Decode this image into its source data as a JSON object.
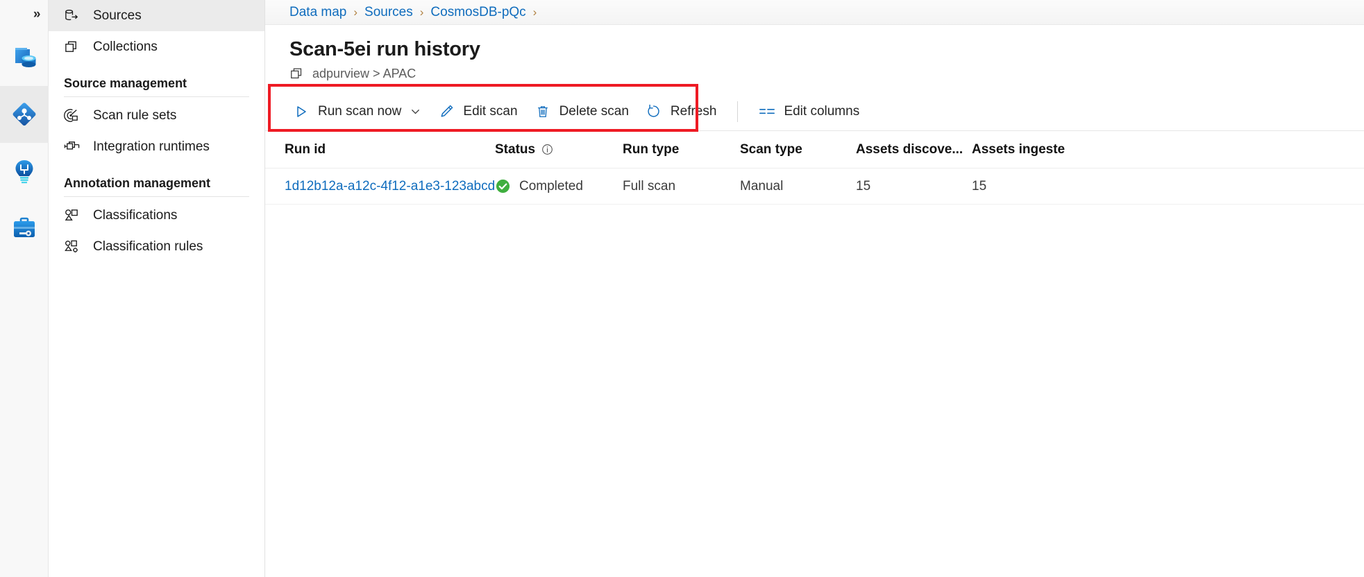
{
  "colors": {
    "link": "#0f6cbd",
    "accent_blue": "#0078d4",
    "highlight_red": "#ee1b24",
    "status_green": "#3faf3f",
    "sidebar_selected": "#ebebeb",
    "text": "#1b1b1b"
  },
  "rail": {
    "expand_label": "»",
    "items": [
      {
        "name": "data-catalog-icon",
        "title": "Data catalog"
      },
      {
        "name": "data-map-icon",
        "title": "Data map",
        "active": true
      },
      {
        "name": "insights-icon",
        "title": "Insights"
      },
      {
        "name": "management-icon",
        "title": "Management"
      }
    ]
  },
  "sidebar": {
    "items": [
      {
        "id": "sources",
        "label": "Sources",
        "icon": "sources-icon",
        "selected": true
      },
      {
        "id": "collections",
        "label": "Collections",
        "icon": "collections-icon",
        "selected": false
      }
    ],
    "sections": [
      {
        "heading": "Source management",
        "items": [
          {
            "id": "scan-rule-sets",
            "label": "Scan rule sets",
            "icon": "scan-rule-sets-icon"
          },
          {
            "id": "integration-runtimes",
            "label": "Integration runtimes",
            "icon": "integration-runtimes-icon"
          }
        ]
      },
      {
        "heading": "Annotation management",
        "items": [
          {
            "id": "classifications",
            "label": "Classifications",
            "icon": "classifications-icon"
          },
          {
            "id": "classification-rules",
            "label": "Classification rules",
            "icon": "classification-rules-icon"
          }
        ]
      }
    ]
  },
  "breadcrumb": {
    "separator": "›",
    "items": [
      {
        "label": "Data map"
      },
      {
        "label": "Sources"
      },
      {
        "label": "CosmosDB-pQc"
      }
    ],
    "trailing_separator": "›"
  },
  "page": {
    "title": "Scan-5ei run history",
    "subtitle": "adpurview > APAC",
    "subtitle_icon": "collections-icon"
  },
  "toolbar": {
    "run_scan_now": "Run scan now",
    "run_scan_now_icon": "play-icon",
    "run_scan_now_caret": "chevron-down-icon",
    "edit_scan": "Edit scan",
    "edit_scan_icon": "pencil-icon",
    "delete_scan": "Delete scan",
    "delete_scan_icon": "trash-icon",
    "refresh": "Refresh",
    "refresh_icon": "refresh-icon",
    "edit_columns": "Edit columns",
    "edit_columns_icon": "edit-columns-icon"
  },
  "table": {
    "columns": [
      {
        "key": "run_id",
        "label": "Run id"
      },
      {
        "key": "status",
        "label": "Status",
        "info_icon": "info-icon"
      },
      {
        "key": "run_type",
        "label": "Run type"
      },
      {
        "key": "scan_type",
        "label": "Scan type"
      },
      {
        "key": "assets_discovered",
        "label": "Assets discove..."
      },
      {
        "key": "assets_ingested",
        "label": "Assets ingeste"
      }
    ],
    "rows": [
      {
        "run_id": "1d12b12a-a12c-4f12-a1e3-123abcd",
        "status": "Completed",
        "status_icon": "check-circle-icon",
        "run_type": "Full scan",
        "scan_type": "Manual",
        "assets_discovered": "15",
        "assets_ingested": "15"
      }
    ]
  }
}
